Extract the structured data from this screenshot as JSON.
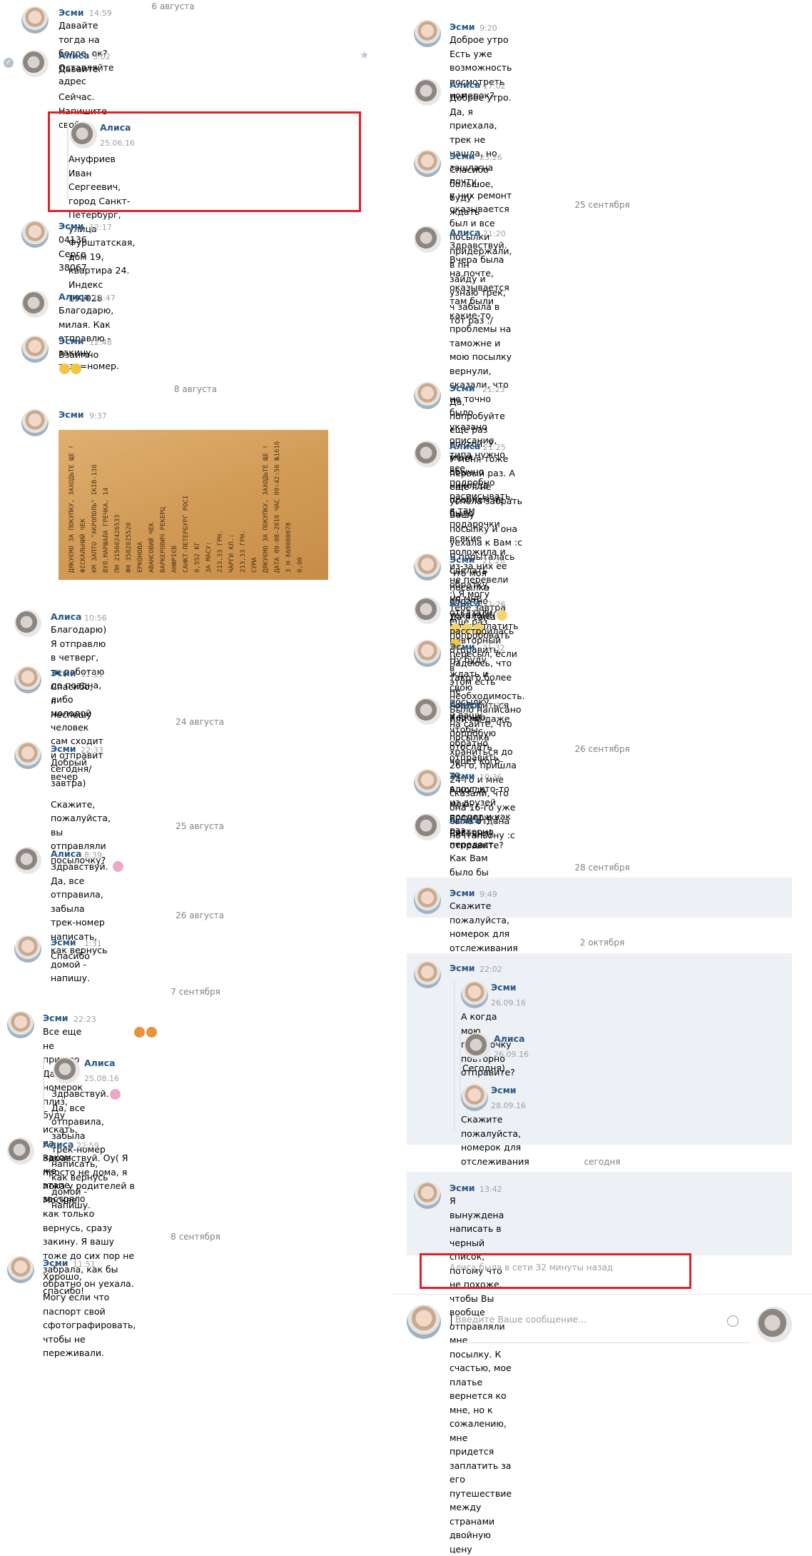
{
  "left": {
    "dates": [
      "6 августа",
      "8 августа",
      "24 августа",
      "25 августа",
      "26 августа",
      "7 сентября",
      "8 сентября"
    ],
    "messages": [
      {
        "name": "Эсми",
        "time": "14:59",
        "text": "Давайте тогда на белое, ок? Оставляйте адрес"
      },
      {
        "name": "Алиса",
        "time": "5:02",
        "text": "Давайте.\n\nСейчас. Напишите свой."
      },
      {
        "name": "Эсми",
        "time": "12:17",
        "text": "04136\nСерге\n38067"
      },
      {
        "name": "Алиса",
        "time": "12:47",
        "text": "Благодарю, милая. Как отправлю - закину трэк=номер."
      },
      {
        "name": "Эсми",
        "time": "12:48",
        "text": "Взаимно"
      },
      {
        "name": "Эсми",
        "time": "9:37",
        "text": ""
      },
      {
        "name": "Алиса",
        "time": "10:56",
        "text": "Благодарю) Я отправлю в четверг, тк работаю до поздна, либо\nмолодой человек сам сходит и отправит сегодня/завтра)"
      },
      {
        "name": "Эсми",
        "time": "11:11",
        "text": "Спасибо, я неспешу"
      },
      {
        "name": "Эсми",
        "time": "22:33",
        "text": "Добрый вечер\n\nСкажите, пожалуйста, вы отправляли посылочку?"
      },
      {
        "name": "Алиса",
        "time": "8:39",
        "text": "Здравствуй.     Да, все отправила, забыла трек-номер\nнаписать, как вернусь домой - напишу."
      },
      {
        "name": "Эсми",
        "time": "1:31",
        "text": "Спасибо"
      },
      {
        "name": "Эсми",
        "time": "22:23",
        "text": "Все еще не пришло       Дайте номерок плиз, буду искать, на\nкаком же этапе застряло"
      },
      {
        "name": "Алиса",
        "time": "22:59",
        "text": "Здравствуй. Оу( Я просто не дома, я пока у родителей в Москве,\nкак только вернусь, сразу закину. Я вашу тоже до сих пор не\nзабрала, как бы обратно он уехала. Могу если что паспорт свой\nсфотографировать, чтобы не переживали."
      },
      {
        "name": "Эсми",
        "time": "11:51",
        "text": "Хорошо, спасибо!"
      }
    ],
    "quotes": [
      {
        "name": "Алиса",
        "date": "25.06.16",
        "text": "Ануфриев Иван Сергеевич, город Санкт-Петербург, улица\nФурштатская, дом 19, квартира 24.\nИндекс 191028"
      },
      {
        "name": "Алиса",
        "date": "25.08.16",
        "text": "Здравствуй.     Да, все отправила, забыла трек-номер\nнаписать, как вернусь домой - напишу."
      }
    ],
    "receipt_lines": [
      "ДЯКУЄМО ЗА ПОКУПКУ, ЗАХОДЬТЕ ЩЕ !",
      "ФІСКАЛЬНИЙ ЧЕК",
      "КМ ЗАПТО \"АКРОПОЛЬ\"  ІКІВ-136",
      "ВУЛ.МАРШАЛА ГРЕЧКА, 14",
      "ПН 215602426533",
      "ФН 3582025520",
      "ЕРКОНОВА",
      "АВАНСОВИЙ ЧЕК",
      "ВАРКЕРОВИЧ РЕКЕРЦ",
      "АНФРІЄВ",
      "САНКТ-ПЕТЕРБУРГ РОСІ",
      "0,552 КГ",
      "ЗА МАСУ:",
      "213,33 ГРН.",
      "ЧАРГИ КЛ.:",
      "213,33 ГРН.",
      "СУМА",
      "ДЯКУЄМО ЗА ПОКУПКУ, ЗАХОДЬТЕ ЩЕ !",
      "ДАТА 09-08-2016 ЧАС 09:42:56 №1616",
      "3 Н 660000078",
      "0,00"
    ]
  },
  "right": {
    "dates": [
      "25 сентября",
      "26 сентября",
      "28 сентября",
      "2 октября",
      "сегодня"
    ],
    "messages": [
      {
        "name": "Эсми",
        "time": "9:20",
        "text": "Доброе утро\nЕсть уже возможность посмотреть номерок?"
      },
      {
        "name": "Алиса",
        "time": "17:02",
        "text": "Доброе утро. Да, я приехала, трек не нашла, но зашла на почту,\nу них ремонт оказывается был и все посылки придержали, в пн\nзайду и узнаю трек, ч забыла в тот раз :/"
      },
      {
        "name": "Эсми",
        "time": "23:26",
        "text": "Спасибо большое, буду ждать"
      },
      {
        "name": "Алиса",
        "time": "21:20",
        "text": "Здравствуй. Вчера была на почте, оказывается там были\nкакие-то проблемы на таможне и мою посылку вернули,\nсказали, что не точно было указано описание, типа нужно все\nподробно расписывать, я там подарочки всякие положила и\nиз-за них ее не перевели :\\ Я могу тебе завтра еще раз\nпопробовать отправить, надеюсь, что такого более не\nповториться или мб даже попробую отослать через кого-то,\nвдруг кто-то из друзей поедет и как раз передаст. Как Вам\nбыло бы удобнее?"
      },
      {
        "name": "Эсми",
        "time": "21:23",
        "text": "Да, попробуйте еще раз почтой. У меня обычно никогда\nпроблем не было"
      },
      {
        "name": "Алиса",
        "time": "21:25",
        "text": "У меня тоже первый раз. А еще я не успела забрать Вашу\nпосылку и она уехала к Вам :с Я попыталась сделать обратку,\nно мне отказали, я могу оплатить повторный пересыл, если в\nэтом есть необходимость. Было написано на сайте, что\nпосылка храниться до 26-го, пришла 24-го и мне сказали, что\nона 16-го уже была отдана почтальону :с"
      },
      {
        "name": "Эсми",
        "time": "21:26",
        "text": "Что моя посылка обратно уехала(((("
      },
      {
        "name": "Алиса",
        "time": "21:26",
        "text": "Да я сама расстроилась"
      },
      {
        "name": "Эсми",
        "time": "21:32",
        "text": "Ну буду ждать и свою посылку, и вашу, чтобы обратно\nотправить"
      },
      {
        "name": "Алиса",
        "time": "21:32",
        "text": "Хорошо"
      },
      {
        "name": "Эсми",
        "time": "10:36",
        "text": "А когда мою посылочку повторно отправите?"
      },
      {
        "name": "Алиса",
        "time": "13:45",
        "text": "Сегодня)"
      },
      {
        "name": "Эсми",
        "time": "9:49",
        "text": "Скажите пожалуйста, номерок для отслеживания"
      },
      {
        "name": "Эсми",
        "time": "22:02",
        "text": ""
      },
      {
        "name": "Эсми",
        "time": "13:42",
        "text": "Я вынуждена написать в черный список, потому что не похоже,\nчтобы Вы вообще отправляли мне посылку. К счастью, мое\nплатье вернется ко мне, но к сожалению, мне придется\nзаплатить за его путешествие между странами двойную цену"
      }
    ],
    "forwarded": [
      {
        "name": "Эсми",
        "date": "26.09.16",
        "text": "А когда мою посылочку повторно отправите?"
      },
      {
        "name": "Алиса",
        "date": "26.09.16",
        "text": "Сегодня)"
      },
      {
        "name": "Эсми",
        "date": "28.09.16",
        "text": "Скажите пожалуйста, номерок для отслеживания"
      }
    ],
    "online_status": "Алиса была в сети 32 минуты назад",
    "input_placeholder": "Введите Ваше сообщение..."
  },
  "icons": {
    "favorite": "star-icon",
    "read": "check-icon",
    "emoji": "smile-icon"
  },
  "colors": {
    "name": "#2a5885",
    "highlight": "#edf0f5",
    "redbox": "#e0202a",
    "meta": "#a0a0a0"
  }
}
